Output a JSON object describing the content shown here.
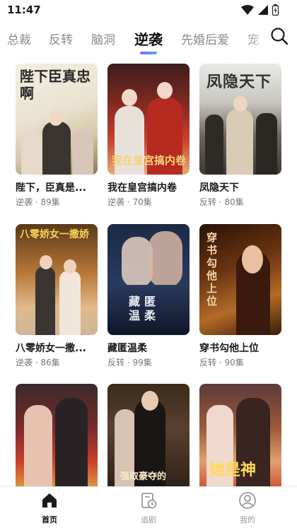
{
  "status_bar": {
    "time": "11:47"
  },
  "tabs": [
    {
      "label": "总裁"
    },
    {
      "label": "反转"
    },
    {
      "label": "脑洞"
    },
    {
      "label": "逆袭"
    },
    {
      "label": "先婚后爱"
    },
    {
      "label": "宠"
    }
  ],
  "active_tab": "逆袭",
  "cards": [
    {
      "title": "陛下，臣真是...",
      "tag": "逆袭",
      "episodes": "89集",
      "poster_text": "陛下臣真忠啊"
    },
    {
      "title": "我在皇宫搞内卷",
      "tag": "逆袭",
      "episodes": "70集",
      "poster_text": "我在皇宫搞内卷"
    },
    {
      "title": "凤隐天下",
      "tag": "反转",
      "episodes": "80集",
      "poster_text": "凤隐天下"
    },
    {
      "title": "八零娇女一撒...",
      "tag": "逆袭",
      "episodes": "86集",
      "poster_text": "八零娇女一撒娇"
    },
    {
      "title": "藏匿温柔",
      "tag": "反转",
      "episodes": "99集",
      "poster_text": "藏匿温柔"
    },
    {
      "title": "穿书勾他上位",
      "tag": "反转",
      "episodes": "90集",
      "poster_text": "穿书勾他上位"
    },
    {
      "title": "",
      "tag": "",
      "episodes": "",
      "poster_text": ""
    },
    {
      "title": "",
      "tag": "",
      "episodes": "",
      "poster_text": "强取豪夺的"
    },
    {
      "title": "",
      "tag": "",
      "episodes": "",
      "poster_text": "她是神"
    }
  ],
  "bottom_nav": [
    {
      "label": "首页",
      "icon": "home-icon"
    },
    {
      "label": "追剧",
      "icon": "history-icon"
    },
    {
      "label": "我的",
      "icon": "profile-icon"
    }
  ],
  "colors": {
    "accent_start": "#7c6cf0",
    "accent_end": "#5fa8f5",
    "meta": "#777777"
  }
}
